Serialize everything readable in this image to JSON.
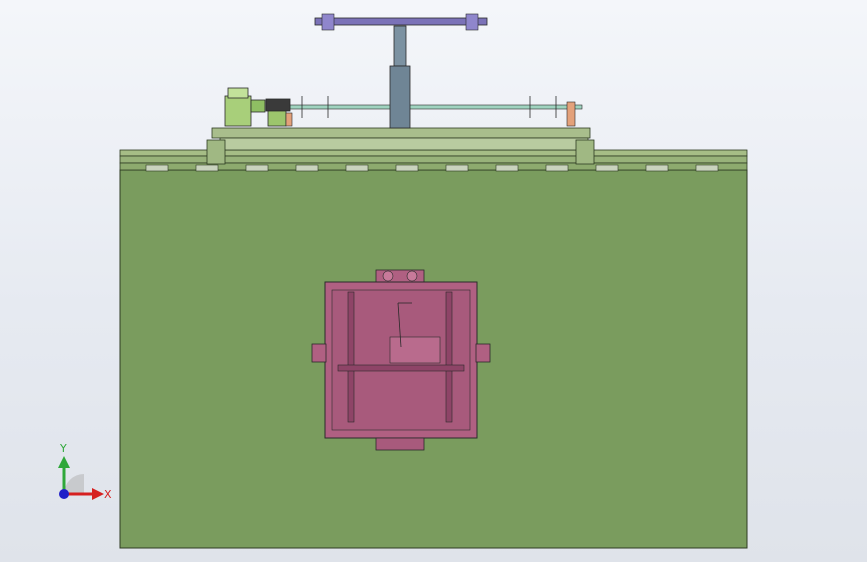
{
  "viewport": {
    "background_top": "#f4f6fa",
    "background_bottom": "#dfe3ea"
  },
  "model": {
    "colors": {
      "base_plate": "#7a9c5e",
      "base_outline": "#2e3b22",
      "rail": "#b3c49a",
      "rail_block": "#a4b98a",
      "shaft": "#9fd3bf",
      "column": "#6f8595",
      "crossbar": "#7b72b8",
      "gear_green": "#a8cf7a",
      "orange_part": "#e3a17a",
      "fixture": "#b06082",
      "fixture_dark": "#8e4467",
      "outline": "#2a2a2a"
    }
  },
  "triad": {
    "x_label": "X",
    "y_label": "Y",
    "x_color": "#d62020",
    "y_color": "#2fa83a",
    "z_color": "#2020c8"
  }
}
